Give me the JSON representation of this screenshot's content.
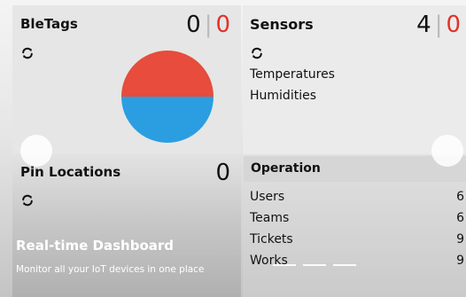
{
  "bletags": {
    "title": "BleTags",
    "count_a": "0",
    "separator": "|",
    "count_b": "0"
  },
  "sensors": {
    "title": "Sensors",
    "count_a": "4",
    "separator": "|",
    "count_b": "0",
    "items": [
      "Temperatures",
      "Humidities"
    ]
  },
  "pin_locations": {
    "title": "Pin Locations",
    "count": "0"
  },
  "operation": {
    "title": "Operation",
    "rows": [
      {
        "label": "Users",
        "value": "6"
      },
      {
        "label": "Teams",
        "value": "6"
      },
      {
        "label": "Tickets",
        "value": "9"
      },
      {
        "label": "Works",
        "value": "9"
      }
    ]
  },
  "carousel": {
    "title": "Real-time Dashboard",
    "text": "Monitor all your IoT devices in one place",
    "slide_count": 3
  },
  "colors": {
    "accent_red": "#e0322c",
    "pie_red": "#e74c3c",
    "pie_blue": "#2a9ee0"
  },
  "icons": {
    "refresh": "refresh-icon"
  }
}
